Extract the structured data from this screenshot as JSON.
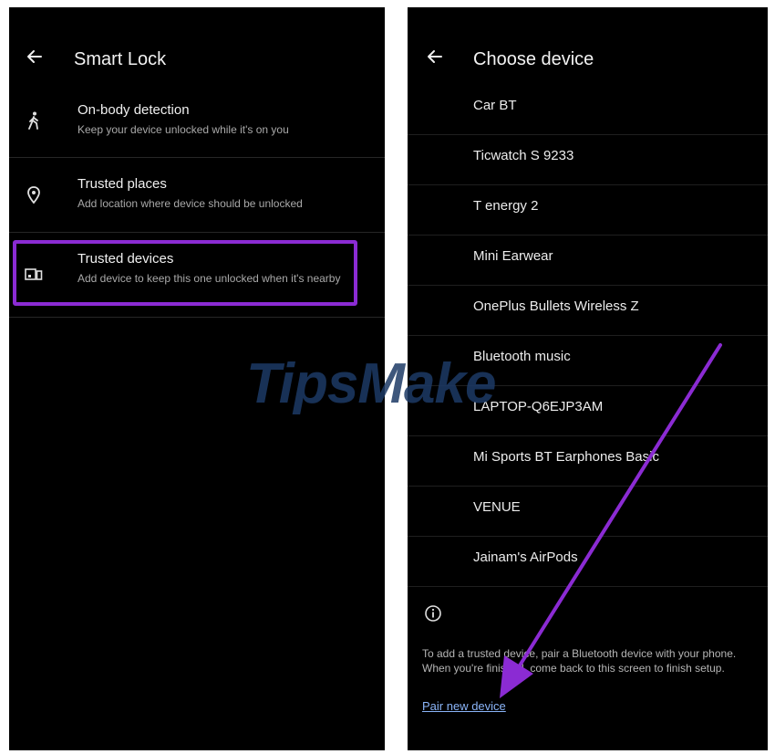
{
  "left": {
    "title": "Smart Lock",
    "items": [
      {
        "icon": "walking-person-icon",
        "title": "On-body detection",
        "subtitle": "Keep your device unlocked while it's on you"
      },
      {
        "icon": "location-pin-icon",
        "title": "Trusted places",
        "subtitle": "Add location where device should be unlocked"
      },
      {
        "icon": "devices-icon",
        "title": "Trusted devices",
        "subtitle": "Add device to keep this one unlocked when it's nearby"
      }
    ]
  },
  "right": {
    "title": "Choose device",
    "devices": [
      "Car BT",
      "Ticwatch S 9233",
      "T energy 2",
      "Mini Earwear",
      "OnePlus Bullets Wireless Z",
      "Bluetooth music",
      "LAPTOP-Q6EJP3AM",
      "Mi Sports BT Earphones Basic",
      "VENUE",
      "Jainam's AirPods"
    ],
    "info_text": "To add a trusted device, pair a Bluetooth device with your phone. When you're finished, come back to this screen to finish setup.",
    "pair_link": "Pair new device"
  },
  "watermark": "TipsMake",
  "colors": {
    "highlight": "#8b2bd3",
    "link": "#8ab4f8",
    "background": "#000000"
  }
}
